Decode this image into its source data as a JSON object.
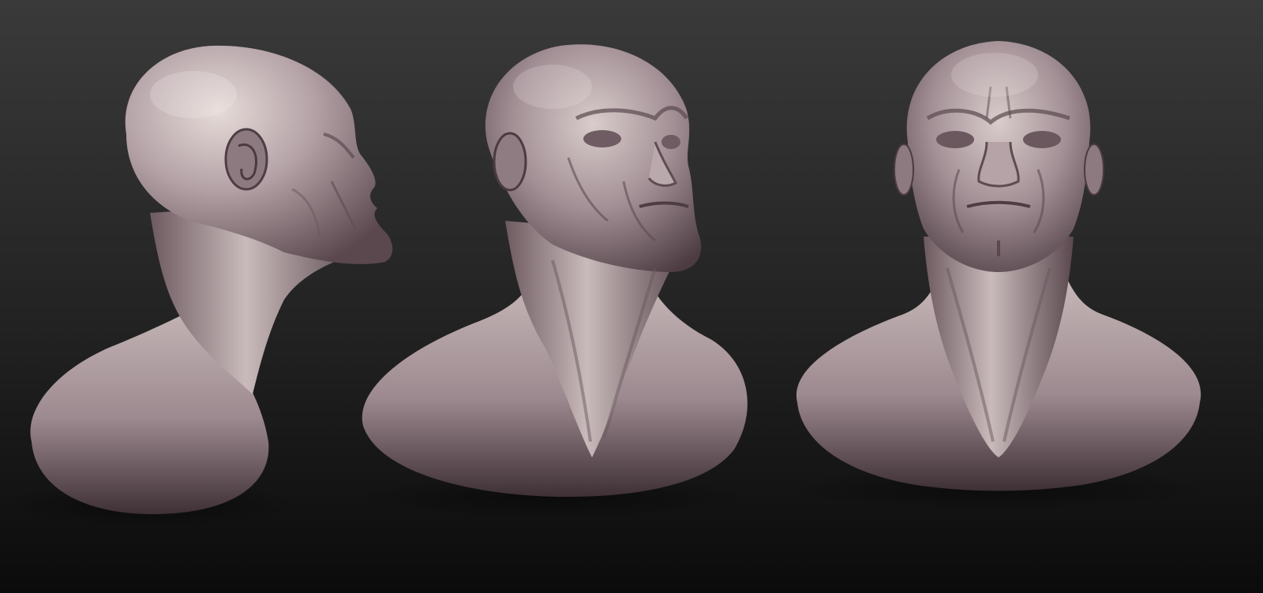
{
  "scene": {
    "views": [
      {
        "view": "side-profile"
      },
      {
        "view": "three-quarter"
      },
      {
        "view": "front"
      }
    ]
  },
  "colors": {
    "background_top": "#3a3a3a",
    "background_bottom": "#0b0b0b",
    "clay_light": "#ded2d0",
    "clay_mid": "#a8959b",
    "clay_dark": "#5e4d53",
    "clay_shadow": "#3a2d31"
  }
}
